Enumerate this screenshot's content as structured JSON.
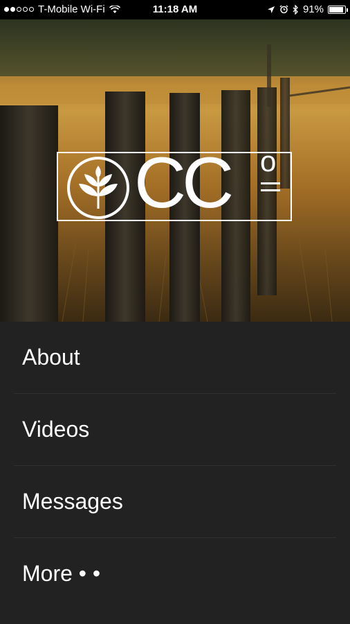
{
  "status_bar": {
    "carrier": "T-Mobile Wi-Fi",
    "time": "11:18 AM",
    "battery": "91%",
    "battery_level": 0.91,
    "icons": [
      "signal-dots-icon",
      "wifi-icon",
      "location-icon",
      "alarm-icon",
      "bluetooth-icon",
      "battery-icon"
    ]
  },
  "logo": {
    "icon": "leaf-emblem-icon",
    "text": "CC",
    "superscript": "o"
  },
  "menu": {
    "items": [
      {
        "label": "About"
      },
      {
        "label": "Videos"
      },
      {
        "label": "Messages"
      },
      {
        "label": "More • •"
      }
    ]
  },
  "colors": {
    "background": "#222222",
    "divider": "#2c3032",
    "text": "#ffffff"
  }
}
